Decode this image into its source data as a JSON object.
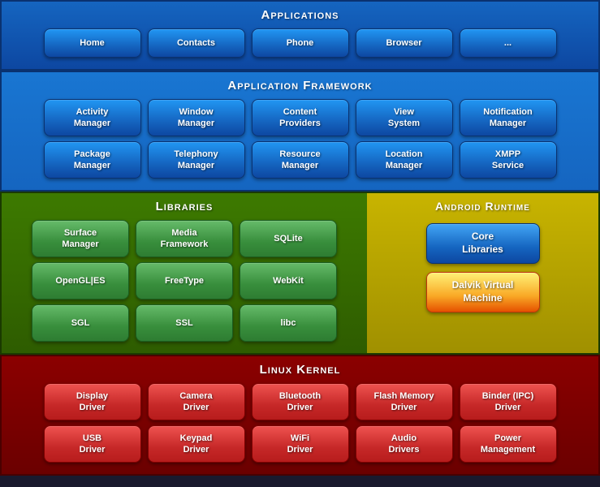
{
  "applications": {
    "title": "Applications",
    "buttons": [
      "Home",
      "Contacts",
      "Phone",
      "Browser",
      "..."
    ]
  },
  "framework": {
    "title": "Application Framework",
    "row1": [
      {
        "label": "Activity\nManager"
      },
      {
        "label": "Window\nManager"
      },
      {
        "label": "Content\nProviders"
      },
      {
        "label": "View\nSystem"
      },
      {
        "label": "Notification\nManager"
      }
    ],
    "row2": [
      {
        "label": "Package\nManager"
      },
      {
        "label": "Telephony\nManager"
      },
      {
        "label": "Resource\nManager"
      },
      {
        "label": "Location\nManager"
      },
      {
        "label": "XMPP\nService"
      }
    ]
  },
  "libraries": {
    "title": "Libraries",
    "row1": [
      "Surface\nManager",
      "Media\nFramework",
      "SQLite"
    ],
    "row2": [
      "OpenGL|ES",
      "FreeType",
      "WebKit"
    ],
    "row3": [
      "SGL",
      "SSL",
      "libc"
    ]
  },
  "android_runtime": {
    "title": "Android Runtime",
    "btn1": "Core\nLibraries",
    "btn2": "Dalvik Virtual\nMachine"
  },
  "kernel": {
    "title": "Linux Kernel",
    "row1": [
      "Display\nDriver",
      "Camera\nDriver",
      "Bluetooth\nDriver",
      "Flash Memory\nDriver",
      "Binder (IPC)\nDriver"
    ],
    "row2": [
      "USB\nDriver",
      "Keypad\nDriver",
      "WiFi\nDriver",
      "Audio\nDrivers",
      "Power\nManagement"
    ]
  }
}
